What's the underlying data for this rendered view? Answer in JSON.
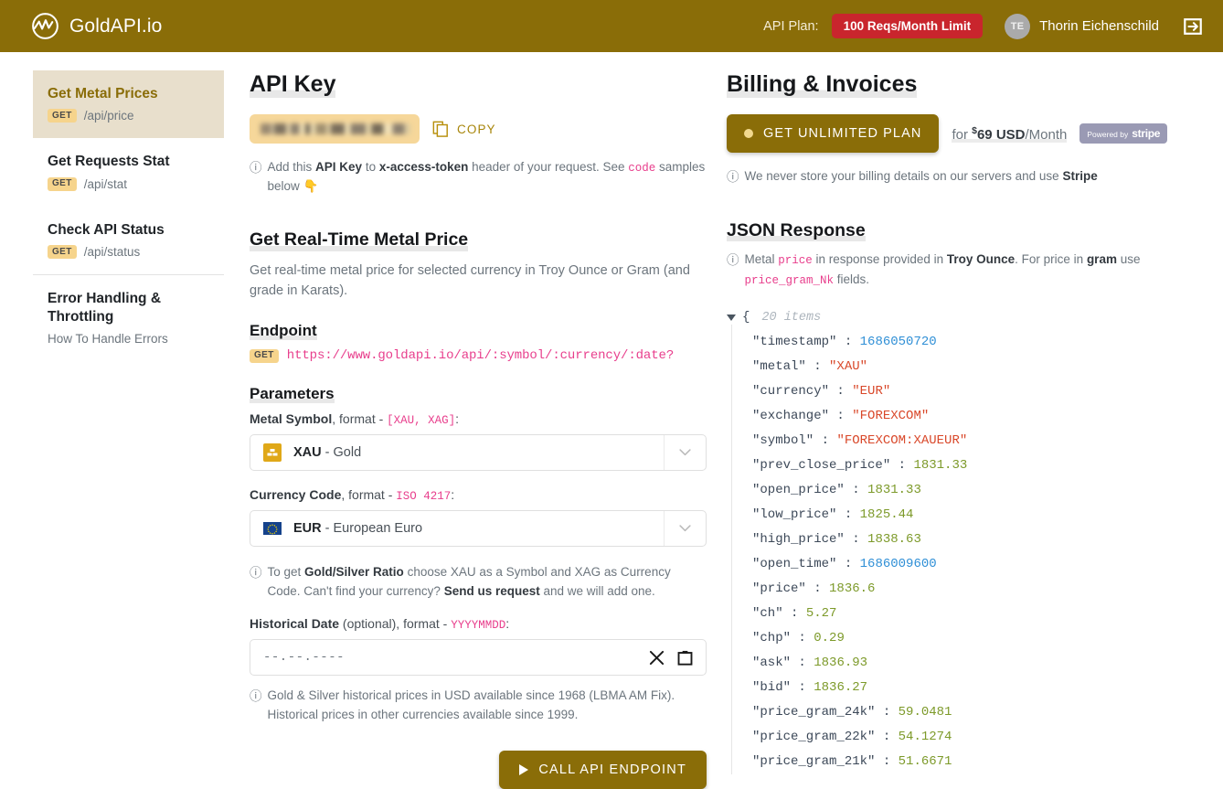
{
  "header": {
    "brand_name": "GoldAPI.io",
    "brand_logo_icon": "goldapi-wave-circle-logo",
    "api_plan_label": "API Plan:",
    "plan_badge": "100 Reqs/Month Limit",
    "avatar_initials": "TE",
    "user_name": "Thorin Eichenschild",
    "logout_icon": "logout-arrow-icon",
    "bg_color": "#8a6d08",
    "badge_color": "#c9252d"
  },
  "sidebar": {
    "items": [
      {
        "title": "Get Metal Prices",
        "method": "GET",
        "path": "/api/price",
        "active": true
      },
      {
        "title": "Get Requests Stat",
        "method": "GET",
        "path": "/api/stat",
        "active": false
      },
      {
        "title": "Check API Status",
        "method": "GET",
        "path": "/api/status",
        "active": false
      }
    ],
    "footer_item": {
      "title": "Error Handling & Throttling",
      "desc": "How To Handle Errors"
    }
  },
  "apikey": {
    "heading": "API Key",
    "value_masked": "",
    "copy_label": "COPY",
    "copy_icon": "copy-icon",
    "note_prefix": "Add this ",
    "note_b1": "API Key",
    "note_mid1": " to ",
    "note_b2": "x-access-token",
    "note_mid2": " header of your request. See ",
    "note_code": "code",
    "note_suffix": " samples below ",
    "note_emoji": "👇"
  },
  "metalprice": {
    "heading": "Get Real-Time Metal Price",
    "description": "Get real-time metal price for selected currency in Troy Ounce or Gram (and grade in Karats).",
    "endpoint_heading": "Endpoint",
    "endpoint_method": "GET",
    "endpoint_url": "https://www.goldapi.io/api/:symbol/:currency/:date?",
    "parameters_heading": "Parameters",
    "metal_label_b": "Metal Symbol",
    "metal_label_mid": ", format - ",
    "metal_label_code": "[XAU, XAG]",
    "metal_label_end": ":",
    "metal_icon": "gold-bar-icon",
    "metal_code": "XAU",
    "metal_name": " - Gold",
    "currency_label_b": "Currency Code",
    "currency_label_mid": ", format - ",
    "currency_label_code": "ISO 4217",
    "currency_label_end": ":",
    "currency_icon": "eu-flag-icon",
    "currency_code": "EUR",
    "currency_name": " - European Euro",
    "ratio_note_p1": "To get ",
    "ratio_note_b1": "Gold/Silver Ratio",
    "ratio_note_p2": " choose XAU as a Symbol and XAG as Currency Code. Can't find your currency? ",
    "ratio_note_b2": "Send us request",
    "ratio_note_p3": " and we will add one.",
    "date_label_b": "Historical Date",
    "date_label_mid": " (optional), format - ",
    "date_label_code": "YYYYMMDD",
    "date_label_end": ":",
    "date_value": "",
    "date_placeholder": "--.--.----",
    "date_clear_icon": "clear-x-icon",
    "date_calendar_icon": "calendar-icon",
    "historical_note": "Gold & Silver historical prices in USD available since 1968 (LBMA AM Fix). Historical prices in other currencies available since 1999.",
    "call_button": "CALL API ENDPOINT",
    "call_button_icon": "play-icon"
  },
  "billing": {
    "heading": "Billing & Invoices",
    "button_label": "GET UNLIMITED PLAN",
    "button_dot_icon": "status-dot-icon",
    "price_for": "for ",
    "price_currency_sign": "$",
    "price_amount": "69 USD",
    "price_period": "/Month",
    "stripe_powered": "Powered by",
    "stripe_name": "stripe",
    "note_p1": "We never store your billing details on our servers and use ",
    "note_b1": "Stripe"
  },
  "json_response": {
    "heading": "JSON Response",
    "note_p1": "Metal ",
    "note_code1": "price",
    "note_p2": " in response provided in ",
    "note_b1": "Troy Ounce",
    "note_p3": ". For price in ",
    "note_b2": "gram",
    "note_p4": " use ",
    "note_code2": "price_gram_Nk",
    "note_p5": " fields.",
    "root_brace": "{",
    "items_count": "20 items",
    "fields": [
      {
        "key": "timestamp",
        "value": "1686050720",
        "type": "int"
      },
      {
        "key": "metal",
        "value": "\"XAU\"",
        "type": "str"
      },
      {
        "key": "currency",
        "value": "\"EUR\"",
        "type": "str"
      },
      {
        "key": "exchange",
        "value": "\"FOREXCOM\"",
        "type": "str"
      },
      {
        "key": "symbol",
        "value": "\"FOREXCOM:XAUEUR\"",
        "type": "str"
      },
      {
        "key": "prev_close_price",
        "value": "1831.33",
        "type": "num"
      },
      {
        "key": "open_price",
        "value": "1831.33",
        "type": "num"
      },
      {
        "key": "low_price",
        "value": "1825.44",
        "type": "num"
      },
      {
        "key": "high_price",
        "value": "1838.63",
        "type": "num"
      },
      {
        "key": "open_time",
        "value": "1686009600",
        "type": "int"
      },
      {
        "key": "price",
        "value": "1836.6",
        "type": "num"
      },
      {
        "key": "ch",
        "value": "5.27",
        "type": "num"
      },
      {
        "key": "chp",
        "value": "0.29",
        "type": "num"
      },
      {
        "key": "ask",
        "value": "1836.93",
        "type": "num"
      },
      {
        "key": "bid",
        "value": "1836.27",
        "type": "num"
      },
      {
        "key": "price_gram_24k",
        "value": "59.0481",
        "type": "num"
      },
      {
        "key": "price_gram_22k",
        "value": "54.1274",
        "type": "num"
      },
      {
        "key": "price_gram_21k",
        "value": "51.6671",
        "type": "num"
      }
    ]
  }
}
